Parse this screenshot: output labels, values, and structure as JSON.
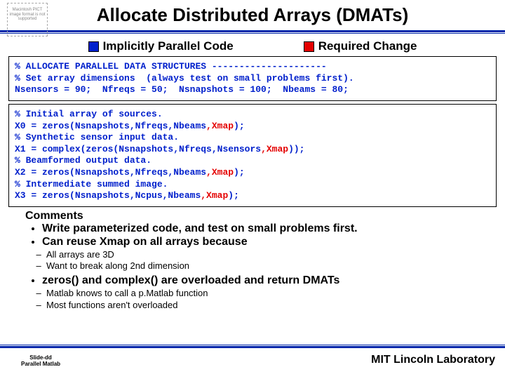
{
  "placeholder": "Macintosh PICT image format is not supported",
  "title": "Allocate Distributed Arrays (DMATs)",
  "legend": {
    "implicit": "Implicitly Parallel Code",
    "required": "Required Change"
  },
  "codebox1": {
    "l1": "% ALLOCATE PARALLEL DATA STRUCTURES ---------------------",
    "l2": "% Set array dimensions  (always test on small problems first).",
    "l3a": "Nsensors = 90;  Nfreqs = 50;  Nsnapshots = 100;  Nbeams = 80;"
  },
  "codebox2": {
    "l1": "% Initial array of sources.",
    "l2a": "X0 = zeros(Nsnapshots,Nfreqs,Nbeams",
    "l2b": ",Xmap",
    "l2c": ");",
    "l3": "% Synthetic sensor input data.",
    "l4a": "X1 = complex(zeros(Nsnapshots,Nfreqs,Nsensors",
    "l4b": ",Xmap",
    "l4c": "));",
    "l5": "% Beamformed output data.",
    "l6a": "X2 = zeros(Nsnapshots,Nfreqs,Nbeams",
    "l6b": ",Xmap",
    "l6c": ");",
    "l7": "% Intermediate summed image.",
    "l8a": "X3 = zeros(Nsnapshots,Ncpus,Nbeams",
    "l8b": ",Xmap",
    "l8c": ");"
  },
  "comments_head": "Comments",
  "bullets1": [
    "Write parameterized code, and test on small problems first.",
    "Can reuse Xmap on all arrays because"
  ],
  "subA": [
    "All arrays are 3D",
    "Want to break along 2nd dimension"
  ],
  "bullet2": "zeros() and complex() are overloaded and return DMATs",
  "subB": [
    "Matlab knows to call a p.Matlab function",
    "Most functions aren't overloaded"
  ],
  "footer": {
    "slide": "Slide-dd",
    "proj": "Parallel Matlab",
    "lab": "MIT Lincoln Laboratory"
  }
}
